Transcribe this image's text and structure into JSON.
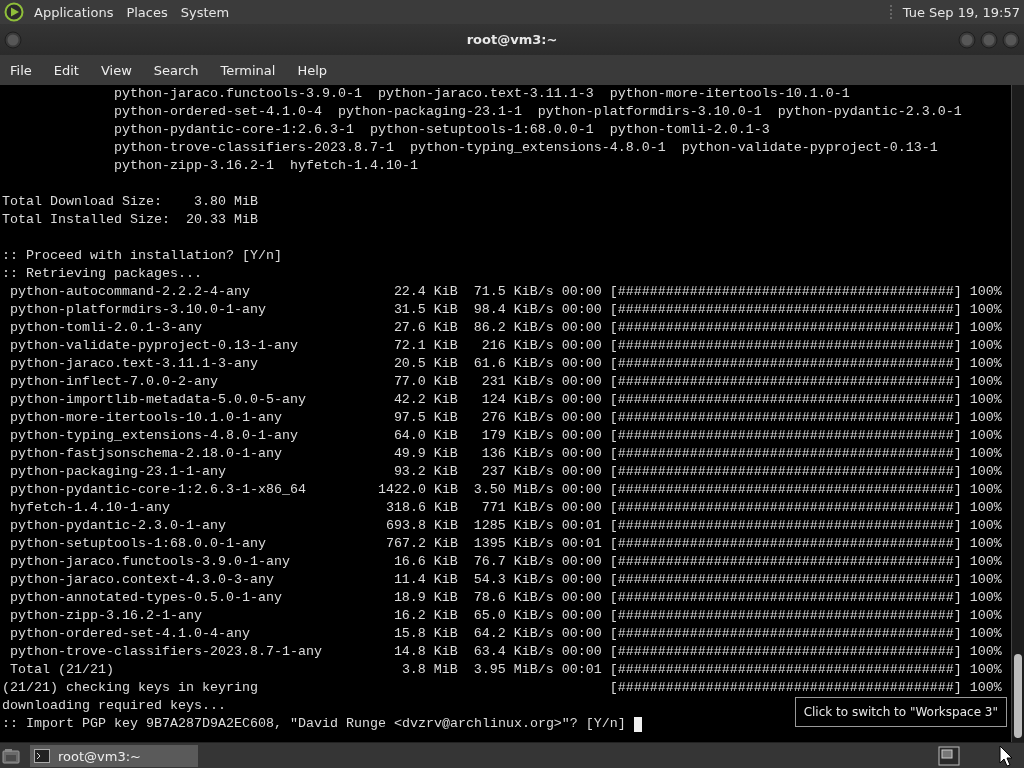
{
  "top_panel": {
    "menus": [
      "Applications",
      "Places",
      "System"
    ],
    "clock": "Tue Sep 19, 19:57"
  },
  "window": {
    "title": "root@vm3:~",
    "menu": [
      "File",
      "Edit",
      "View",
      "Search",
      "Terminal",
      "Help"
    ]
  },
  "terminal": {
    "lines": [
      {
        "kind": "indented",
        "text": "python-jaraco.functools-3.9.0-1  python-jaraco.text-3.11.1-3  python-more-itertools-10.1.0-1"
      },
      {
        "kind": "indented",
        "text": "python-ordered-set-4.1.0-4  python-packaging-23.1-1  python-platformdirs-3.10.0-1  python-pydantic-2.3.0-1"
      },
      {
        "kind": "indented",
        "text": "python-pydantic-core-1:2.6.3-1  python-setuptools-1:68.0.0-1  python-tomli-2.0.1-3"
      },
      {
        "kind": "indented",
        "text": "python-trove-classifiers-2023.8.7-1  python-typing_extensions-4.8.0-1  python-validate-pyproject-0.13-1"
      },
      {
        "kind": "indented",
        "text": "python-zipp-3.16.2-1  hyfetch-1.4.10-1"
      },
      {
        "kind": "blank"
      },
      {
        "kind": "text",
        "text": "Total Download Size:    3.80 MiB"
      },
      {
        "kind": "text",
        "text": "Total Installed Size:  20.33 MiB"
      },
      {
        "kind": "blank"
      },
      {
        "kind": "text",
        "text": ":: Proceed with installation? [Y/n]"
      },
      {
        "kind": "text",
        "text": ":: Retrieving packages..."
      },
      {
        "kind": "download",
        "package": "python-autocommand-2.2.2-4-any",
        "size": "22.4 KiB",
        "speed": "71.5 KiB/s",
        "time": "00:00",
        "bar": "[##########################################]",
        "percent": "100%"
      },
      {
        "kind": "download",
        "package": "python-platformdirs-3.10.0-1-any",
        "size": "31.5 KiB",
        "speed": "98.4 KiB/s",
        "time": "00:00",
        "bar": "[##########################################]",
        "percent": "100%"
      },
      {
        "kind": "download",
        "package": "python-tomli-2.0.1-3-any",
        "size": "27.6 KiB",
        "speed": "86.2 KiB/s",
        "time": "00:00",
        "bar": "[##########################################]",
        "percent": "100%"
      },
      {
        "kind": "download",
        "package": "python-validate-pyproject-0.13-1-any",
        "size": "72.1 KiB",
        "speed": "216 KiB/s",
        "time": "00:00",
        "bar": "[##########################################]",
        "percent": "100%"
      },
      {
        "kind": "download",
        "package": "python-jaraco.text-3.11.1-3-any",
        "size": "20.5 KiB",
        "speed": "61.6 KiB/s",
        "time": "00:00",
        "bar": "[##########################################]",
        "percent": "100%"
      },
      {
        "kind": "download",
        "package": "python-inflect-7.0.0-2-any",
        "size": "77.0 KiB",
        "speed": "231 KiB/s",
        "time": "00:00",
        "bar": "[##########################################]",
        "percent": "100%"
      },
      {
        "kind": "download",
        "package": "python-importlib-metadata-5.0.0-5-any",
        "size": "42.2 KiB",
        "speed": "124 KiB/s",
        "time": "00:00",
        "bar": "[##########################################]",
        "percent": "100%"
      },
      {
        "kind": "download",
        "package": "python-more-itertools-10.1.0-1-any",
        "size": "97.5 KiB",
        "speed": "276 KiB/s",
        "time": "00:00",
        "bar": "[##########################################]",
        "percent": "100%"
      },
      {
        "kind": "download",
        "package": "python-typing_extensions-4.8.0-1-any",
        "size": "64.0 KiB",
        "speed": "179 KiB/s",
        "time": "00:00",
        "bar": "[##########################################]",
        "percent": "100%"
      },
      {
        "kind": "download",
        "package": "python-fastjsonschema-2.18.0-1-any",
        "size": "49.9 KiB",
        "speed": "136 KiB/s",
        "time": "00:00",
        "bar": "[##########################################]",
        "percent": "100%"
      },
      {
        "kind": "download",
        "package": "python-packaging-23.1-1-any",
        "size": "93.2 KiB",
        "speed": "237 KiB/s",
        "time": "00:00",
        "bar": "[##########################################]",
        "percent": "100%"
      },
      {
        "kind": "download",
        "package": "python-pydantic-core-1:2.6.3-1-x86_64",
        "size": "1422.0 KiB",
        "speed": "3.50 MiB/s",
        "time": "00:00",
        "bar": "[##########################################]",
        "percent": "100%"
      },
      {
        "kind": "download",
        "package": "hyfetch-1.4.10-1-any",
        "size": "318.6 KiB",
        "speed": "771 KiB/s",
        "time": "00:00",
        "bar": "[##########################################]",
        "percent": "100%"
      },
      {
        "kind": "download",
        "package": "python-pydantic-2.3.0-1-any",
        "size": "693.8 KiB",
        "speed": "1285 KiB/s",
        "time": "00:01",
        "bar": "[##########################################]",
        "percent": "100%"
      },
      {
        "kind": "download",
        "package": "python-setuptools-1:68.0.0-1-any",
        "size": "767.2 KiB",
        "speed": "1395 KiB/s",
        "time": "00:01",
        "bar": "[##########################################]",
        "percent": "100%"
      },
      {
        "kind": "download",
        "package": "python-jaraco.functools-3.9.0-1-any",
        "size": "16.6 KiB",
        "speed": "76.7 KiB/s",
        "time": "00:00",
        "bar": "[##########################################]",
        "percent": "100%"
      },
      {
        "kind": "download",
        "package": "python-jaraco.context-4.3.0-3-any",
        "size": "11.4 KiB",
        "speed": "54.3 KiB/s",
        "time": "00:00",
        "bar": "[##########################################]",
        "percent": "100%"
      },
      {
        "kind": "download",
        "package": "python-annotated-types-0.5.0-1-any",
        "size": "18.9 KiB",
        "speed": "78.6 KiB/s",
        "time": "00:00",
        "bar": "[##########################################]",
        "percent": "100%"
      },
      {
        "kind": "download",
        "package": "python-zipp-3.16.2-1-any",
        "size": "16.2 KiB",
        "speed": "65.0 KiB/s",
        "time": "00:00",
        "bar": "[##########################################]",
        "percent": "100%"
      },
      {
        "kind": "download",
        "package": "python-ordered-set-4.1.0-4-any",
        "size": "15.8 KiB",
        "speed": "64.2 KiB/s",
        "time": "00:00",
        "bar": "[##########################################]",
        "percent": "100%"
      },
      {
        "kind": "download",
        "package": "python-trove-classifiers-2023.8.7-1-any",
        "size": "14.8 KiB",
        "speed": "63.4 KiB/s",
        "time": "00:00",
        "bar": "[##########################################]",
        "percent": "100%"
      },
      {
        "kind": "download",
        "package": "Total (21/21)",
        "size": "3.8 MiB",
        "speed": "3.95 MiB/s",
        "time": "00:01",
        "bar": "[##########################################]",
        "percent": "100%"
      },
      {
        "kind": "progress",
        "text": "(21/21) checking keys in keyring",
        "bar": "[##########################################]",
        "percent": "100%"
      },
      {
        "kind": "text",
        "text": "downloading required keys..."
      },
      {
        "kind": "prompt",
        "text": ":: Import PGP key 9B7A287D9A2EC608, \"David Runge <dvzrv@archlinux.org>\"? [Y/n]",
        "cursor": true
      }
    ]
  },
  "taskbar": {
    "tasks": [
      "root@vm3:~"
    ],
    "tooltip": "Click to switch to \"Workspace 3\""
  }
}
